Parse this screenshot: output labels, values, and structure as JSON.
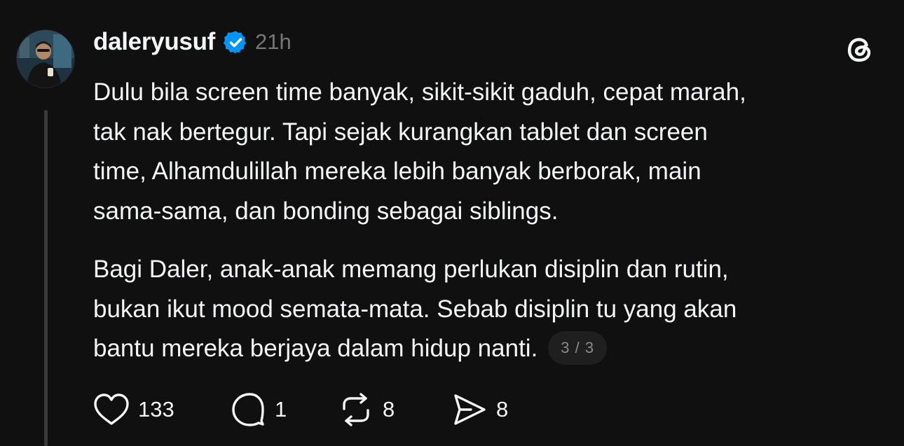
{
  "post": {
    "username": "daleryusuf",
    "timestamp": "21h",
    "paragraphs": [
      "Dulu bila screen time banyak, sikit-sikit gaduh, cepat marah,\ntak nak bertegur. Tapi sejak kurangkan tablet dan screen\ntime, Alhamdulillah mereka lebih banyak berborak, main\nsama-sama, dan bonding sebagai siblings.",
      "Bagi Daler, anak-anak memang perlukan disiplin dan rutin,\nbukan ikut mood semata-mata. Sebab disiplin tu yang akan\nbantu mereka berjaya dalam hidup nanti."
    ],
    "page_indicator": "3 / 3"
  },
  "actions": {
    "likes": "133",
    "replies": "1",
    "reposts": "8",
    "shares": "8"
  },
  "icons": {
    "verified": "verified-badge-icon",
    "app": "threads-logo-icon",
    "like": "heart-icon",
    "reply": "comment-icon",
    "repost": "repost-icon",
    "share": "send-icon"
  },
  "colors": {
    "background": "#101010",
    "text": "#f3f5f7",
    "muted": "#777777",
    "verified": "#0095f6"
  }
}
